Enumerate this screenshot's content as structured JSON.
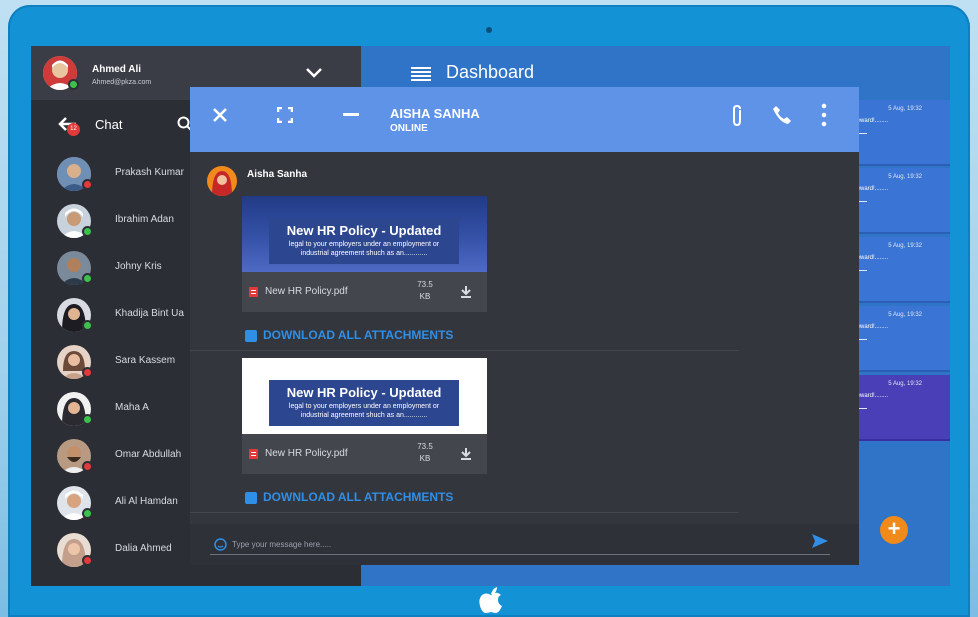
{
  "profile": {
    "name": "Ahmed Ali",
    "email": "Ahmed@pkza.com",
    "status": "online"
  },
  "sidebar": {
    "title": "Chat",
    "badge": "12",
    "contacts": [
      {
        "name": "Prakash Kumar",
        "status": "offline"
      },
      {
        "name": "Ibrahim Adan",
        "status": "online"
      },
      {
        "name": "Johny Kris",
        "status": "online"
      },
      {
        "name": "Khadija Bint Ua",
        "status": "online"
      },
      {
        "name": "Sara Kassem",
        "status": "offline"
      },
      {
        "name": "Maha A",
        "status": "online"
      },
      {
        "name": "Omar Abdullah",
        "status": "offline"
      },
      {
        "name": "Ali Al Hamdan",
        "status": "online"
      },
      {
        "name": "Dalia Ahmed",
        "status": "offline"
      }
    ]
  },
  "dashboard": {
    "title": "Dashboard",
    "cards": [
      {
        "time": "5 Aug, 19:32",
        "text": "teward!........"
      },
      {
        "time": "5 Aug, 19:32",
        "text": "teward!........"
      },
      {
        "time": "5 Aug, 19:32",
        "text": "teward!........"
      },
      {
        "time": "5 Aug, 19:32",
        "text": "teward!........"
      },
      {
        "time": "5 Aug, 19:32",
        "text": "teward!........"
      }
    ],
    "fab_label": "+"
  },
  "chat_window": {
    "contact_name": "AISHA SANHA",
    "contact_status": "ONLINE",
    "sender": "Aisha Sanha",
    "attachments": [
      {
        "banner_title": "New HR Policy - Updated",
        "banner_subtitle": "legal to your employers under an employment or industrial agreement shuch as an............",
        "file_name": "New HR Policy.pdf",
        "file_size_value": "73.5",
        "file_size_unit": "KB"
      },
      {
        "banner_title": "New HR Policy - Updated",
        "banner_subtitle": "legal to your employers under an employment or industrial agreement shuch as an............",
        "file_name": "New HR Policy.pdf",
        "file_size_value": "73.5",
        "file_size_unit": "KB"
      }
    ],
    "download_all_label": "DOWNLOAD ALL ATTACHMENTS",
    "composer_placeholder": "Type your message here....."
  },
  "colors": {
    "header_blue": "#5e93e8",
    "dashboard_blue": "#2f74c6",
    "online": "#3ac24b",
    "offline": "#e23a3a",
    "link_blue": "#2f8fe6",
    "fab_orange": "#f08a1a"
  }
}
